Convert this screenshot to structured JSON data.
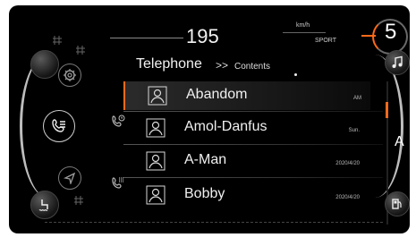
{
  "header": {
    "speed": "195",
    "speed_unit": "km/h",
    "drive_mode": "SPORT",
    "gear": "5"
  },
  "title": {
    "main": "Telephone",
    "separator": ">>",
    "sub": "Contents"
  },
  "contacts": [
    {
      "name": "Abandom",
      "time": "AM"
    },
    {
      "name": "Amol-Danfus",
      "time": "Sun."
    },
    {
      "name": "A-Man",
      "time": "2020/4/20"
    },
    {
      "name": "Bobby",
      "time": "2020/4/20"
    }
  ],
  "index_letter": "A",
  "colors": {
    "accent": "#ff6a1a",
    "background": "#000000",
    "text": "#f0f0f0"
  },
  "icons": [
    "settings-icon",
    "phone-book-icon",
    "navigation-icon",
    "seat-heat-icon",
    "recent-calls-icon",
    "dialpad-icon",
    "music-icon",
    "fuel-icon",
    "contact-icon"
  ]
}
